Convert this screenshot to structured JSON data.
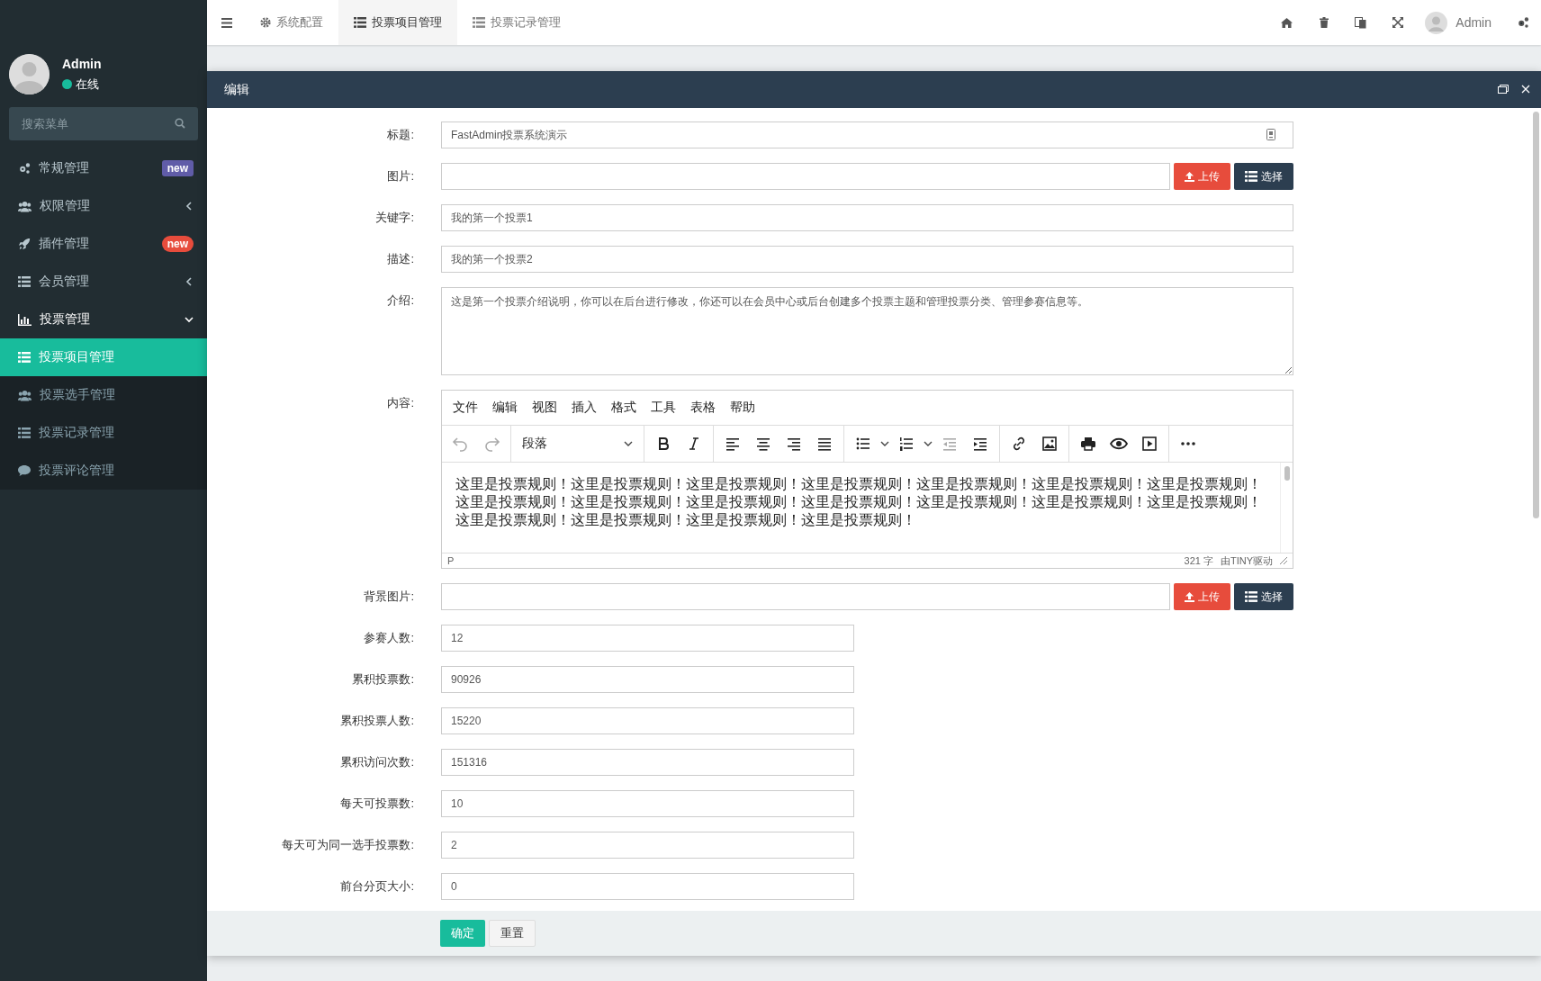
{
  "sidebar": {
    "user": {
      "name": "Admin",
      "status": "在线"
    },
    "search": {
      "placeholder": "搜索菜单"
    },
    "items": [
      {
        "label": "常规管理",
        "badge": {
          "text": "new",
          "color": "#605ca8"
        }
      },
      {
        "label": "权限管理",
        "expanded": false
      },
      {
        "label": "插件管理",
        "badge": {
          "text": "new",
          "color": "#e74c3c"
        }
      },
      {
        "label": "会员管理",
        "expanded": false
      },
      {
        "label": "投票管理",
        "expanded": true,
        "children": [
          {
            "label": "投票项目管理",
            "selected": true
          },
          {
            "label": "投票选手管理",
            "selected": false
          },
          {
            "label": "投票记录管理",
            "selected": false
          },
          {
            "label": "投票评论管理",
            "selected": false
          }
        ]
      }
    ]
  },
  "topbar": {
    "tabs": [
      {
        "label": "系统配置",
        "selected": false
      },
      {
        "label": "投票项目管理",
        "selected": true
      },
      {
        "label": "投票记录管理",
        "selected": false
      }
    ],
    "user": "Admin"
  },
  "modal": {
    "title": "编辑",
    "fields": [
      {
        "kind": "text",
        "label": "标题:",
        "value": "FastAdmin投票系统演示"
      },
      {
        "kind": "upload",
        "label": "图片:",
        "upload": "上传",
        "choose": "选择"
      },
      {
        "kind": "text",
        "label": "关键字:",
        "value": "我的第一个投票1"
      },
      {
        "kind": "text",
        "label": "描述:",
        "value": "我的第一个投票2"
      },
      {
        "kind": "textarea",
        "label": "介绍:",
        "value": "这是第一个投票介绍说明，你可以在后台进行修改，你还可以在会员中心或后台创建多个投票主题和管理投票分类、管理参赛信息等。"
      },
      {
        "kind": "editor",
        "label": "内容:",
        "menu": [
          "文件",
          "编辑",
          "视图",
          "插入",
          "格式",
          "工具",
          "表格",
          "帮助"
        ],
        "block_format": "段落",
        "content": "这里是投票规则！这里是投票规则！这里是投票规则！这里是投票规则！这里是投票规则！这里是投票规则！这里是投票规则！这里是投票规则！这里是投票规则！这里是投票规则！这里是投票规则！这里是投票规则！这里是投票规则！这里是投票规则！这里是投票规则！这里是投票规则！这里是投票规则！这里是投票规则！",
        "path": "P",
        "word_count": "321 字",
        "brand": "由TINY驱动"
      },
      {
        "kind": "upload",
        "label": "背景图片:",
        "upload": "上传",
        "choose": "选择"
      },
      {
        "kind": "number",
        "label": "参赛人数:",
        "value": "12"
      },
      {
        "kind": "number",
        "label": "累积投票数:",
        "value": "90926"
      },
      {
        "kind": "number",
        "label": "累积投票人数:",
        "value": "15220"
      },
      {
        "kind": "number",
        "label": "累积访问次数:",
        "value": "151316"
      },
      {
        "kind": "number",
        "label": "每天可投票数:",
        "value": "10"
      },
      {
        "kind": "number",
        "label": "每天可为同一选手投票数:",
        "value": "2"
      },
      {
        "kind": "number",
        "label": "前台分页大小:",
        "value": "0"
      }
    ],
    "buttons": {
      "confirm": "确定",
      "reset": "重置"
    }
  }
}
